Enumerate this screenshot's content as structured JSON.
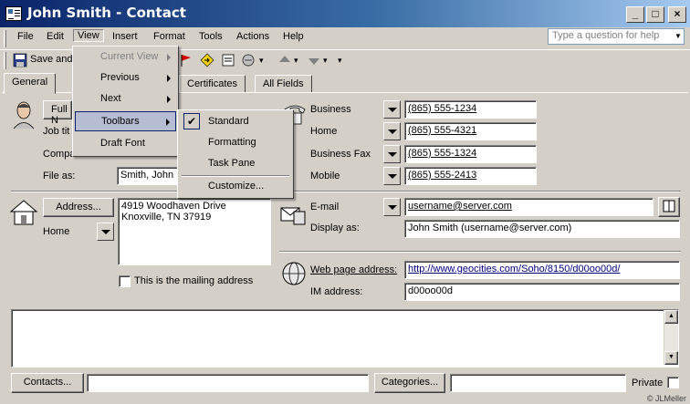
{
  "window": {
    "title": "John Smith - Contact",
    "buttons": [
      "_",
      "□",
      "×"
    ]
  },
  "menubar": {
    "items": [
      "File",
      "Edit",
      "View",
      "Insert",
      "Format",
      "Tools",
      "Actions",
      "Help"
    ],
    "help_placeholder": "Type a question for help"
  },
  "toolbar": {
    "save_label": "Save and"
  },
  "tabs": [
    "General",
    "Certificates",
    "All Fields"
  ],
  "view_menu": {
    "items": [
      {
        "label": "Current View",
        "disabled": true,
        "submenu": true
      },
      {
        "label": "Previous",
        "submenu": true
      },
      {
        "label": "Next",
        "submenu": true
      },
      {
        "label": "Toolbars",
        "submenu": true,
        "highlight": true
      },
      {
        "label": "Draft Font"
      }
    ]
  },
  "toolbars_submenu": {
    "items": [
      {
        "label": "Standard",
        "checked": true
      },
      {
        "label": "Formatting"
      },
      {
        "label": "Task Pane"
      },
      {
        "label": "Customize..."
      }
    ]
  },
  "name_section": {
    "full_name_button": "Full N",
    "job_title_label": "Job tit",
    "company_label": "Compa",
    "file_as_label": "File as:",
    "file_as_value": "Smith, John"
  },
  "phones": [
    {
      "label": "Business",
      "value": "(865) 555-1234"
    },
    {
      "label": "Home",
      "value": "(865) 555-4321"
    },
    {
      "label": "Business Fax",
      "value": "(865) 555-1324"
    },
    {
      "label": "Mobile",
      "value": "(865) 555-2413"
    }
  ],
  "address": {
    "button_label": "Address...",
    "type": "Home",
    "lines": [
      "4919 Woodhaven Drive",
      "Knoxville, TN  37919"
    ],
    "mailing_label": "This is the mailing address"
  },
  "email": {
    "label": "E-mail",
    "value": "username@server.com",
    "display_as_label": "Display as:",
    "display_as_value": "John Smith (username@server.com)"
  },
  "web": {
    "web_label": "Web page address:",
    "web_value": "http://www.geocities.com/Soho/8150/d00oo00d/",
    "im_label": "IM address:",
    "im_value": "d00oo00d"
  },
  "footer": {
    "contacts_button": "Contacts...",
    "categories_button": "Categories...",
    "private_label": "Private",
    "watermark": "© JLMeller"
  }
}
